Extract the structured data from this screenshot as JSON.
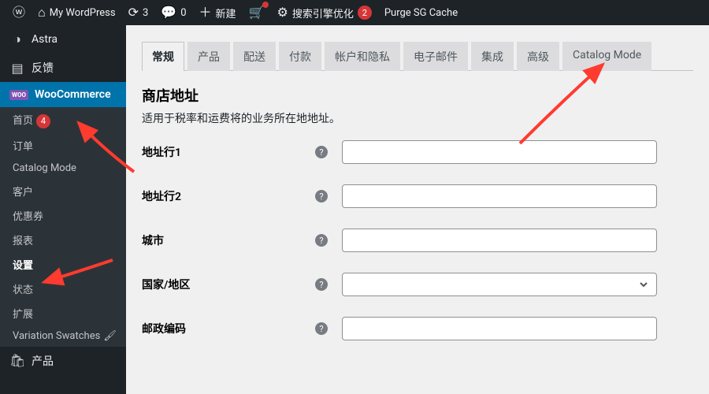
{
  "adminbar": {
    "site_name": "My WordPress",
    "updates_count": "3",
    "comments_count": "0",
    "new_label": "新建",
    "seo_label": "搜索引擎优化",
    "seo_count": "2",
    "purge_label": "Purge SG Cache"
  },
  "sidebar": {
    "astra": "Astra",
    "feedback": "反馈",
    "woocommerce": "WooCommerce",
    "home": "首页",
    "home_badge": "4",
    "orders": "订单",
    "catalog_mode": "Catalog Mode",
    "customers": "客户",
    "coupons": "优惠券",
    "reports": "报表",
    "settings": "设置",
    "status": "状态",
    "extensions": "扩展",
    "swatches": "Variation Swatches",
    "products": "产品"
  },
  "tabs": [
    "常规",
    "产品",
    "配送",
    "付款",
    "帐户和隐私",
    "电子邮件",
    "集成",
    "高级",
    "Catalog Mode"
  ],
  "section": {
    "title": "商店地址",
    "desc": "适用于税率和运费将的业务所在地地址。",
    "fields": [
      {
        "label": "地址行1"
      },
      {
        "label": "地址行2"
      },
      {
        "label": "城市"
      },
      {
        "label": "国家/地区",
        "select": true
      },
      {
        "label": "邮政编码"
      }
    ]
  }
}
